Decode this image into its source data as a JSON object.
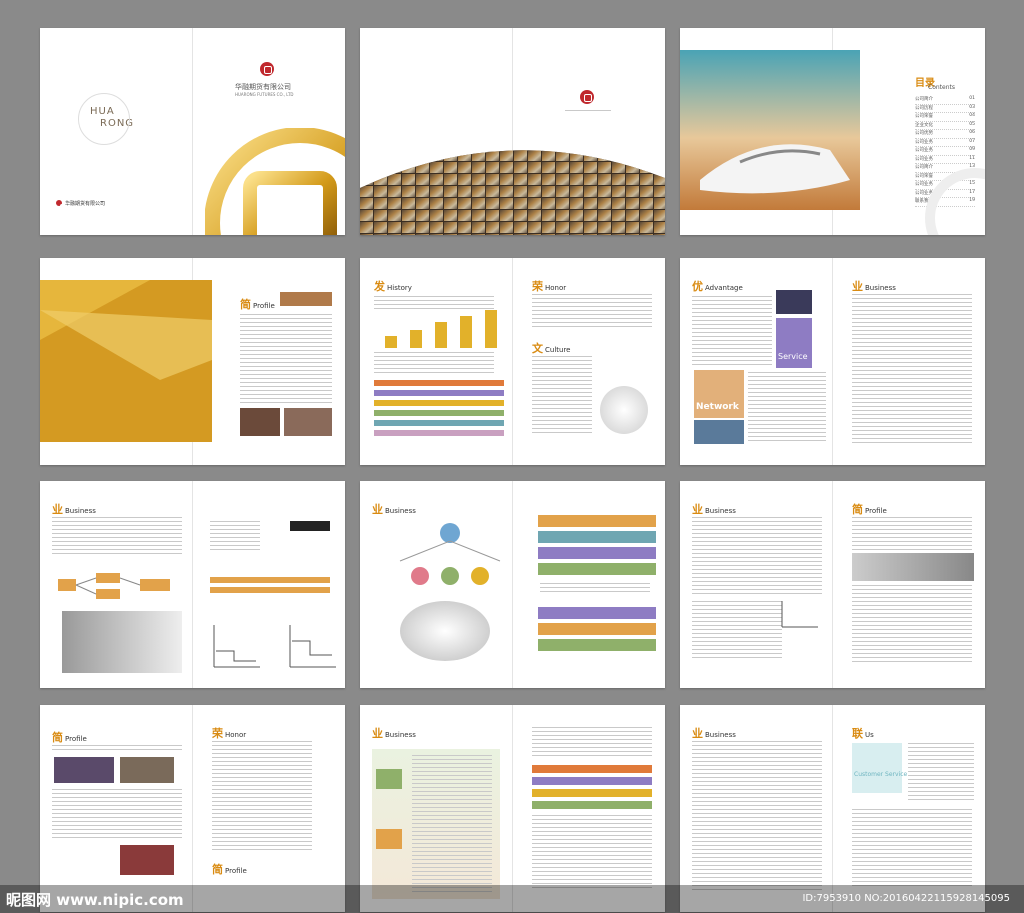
{
  "cover": {
    "company_cn": "华融期货有限公司",
    "company_en": "HUARONG FUTURES CO., LTD",
    "hua": "HUA",
    "rong": "RONG",
    "small_name": "华融期货有限公司"
  },
  "toc": {
    "title_cn": "目录",
    "title_en": "Contents",
    "items": [
      "公司简介",
      "公司历程",
      "公司荣誉",
      "企业文化",
      "公司优势",
      "公司业务",
      "公司业务",
      "公司业务",
      "公司简介",
      "公司荣誉",
      "公司业务",
      "公司业务",
      "联系我们"
    ],
    "pages": [
      "01",
      "03",
      "04",
      "05",
      "06",
      "07",
      "09",
      "11",
      "13",
      "14",
      "15",
      "17",
      "19"
    ]
  },
  "sections": {
    "profile": "Profile",
    "history": "History",
    "honor": "Honor",
    "culture": "Culture",
    "advantage": "Advantage",
    "business": "Business",
    "us": "Us",
    "service_word": "Service",
    "network_word": "Network",
    "customer_service": "Customer Service",
    "jian": "简",
    "fa": "发",
    "rong": "荣",
    "wen": "文",
    "you": "优",
    "ye": "业",
    "lian": "联"
  },
  "footer": {
    "watermark": "昵图网 www.nipic.com",
    "id_text": "ID:7953910 NO:20160422115928145095"
  },
  "colors": {
    "accent": "#d98b12",
    "red": "#c0282d",
    "gold": "#e2b12a",
    "purple": "#8e7cc3",
    "green": "#8fb06a",
    "teal": "#6fa6b2"
  }
}
